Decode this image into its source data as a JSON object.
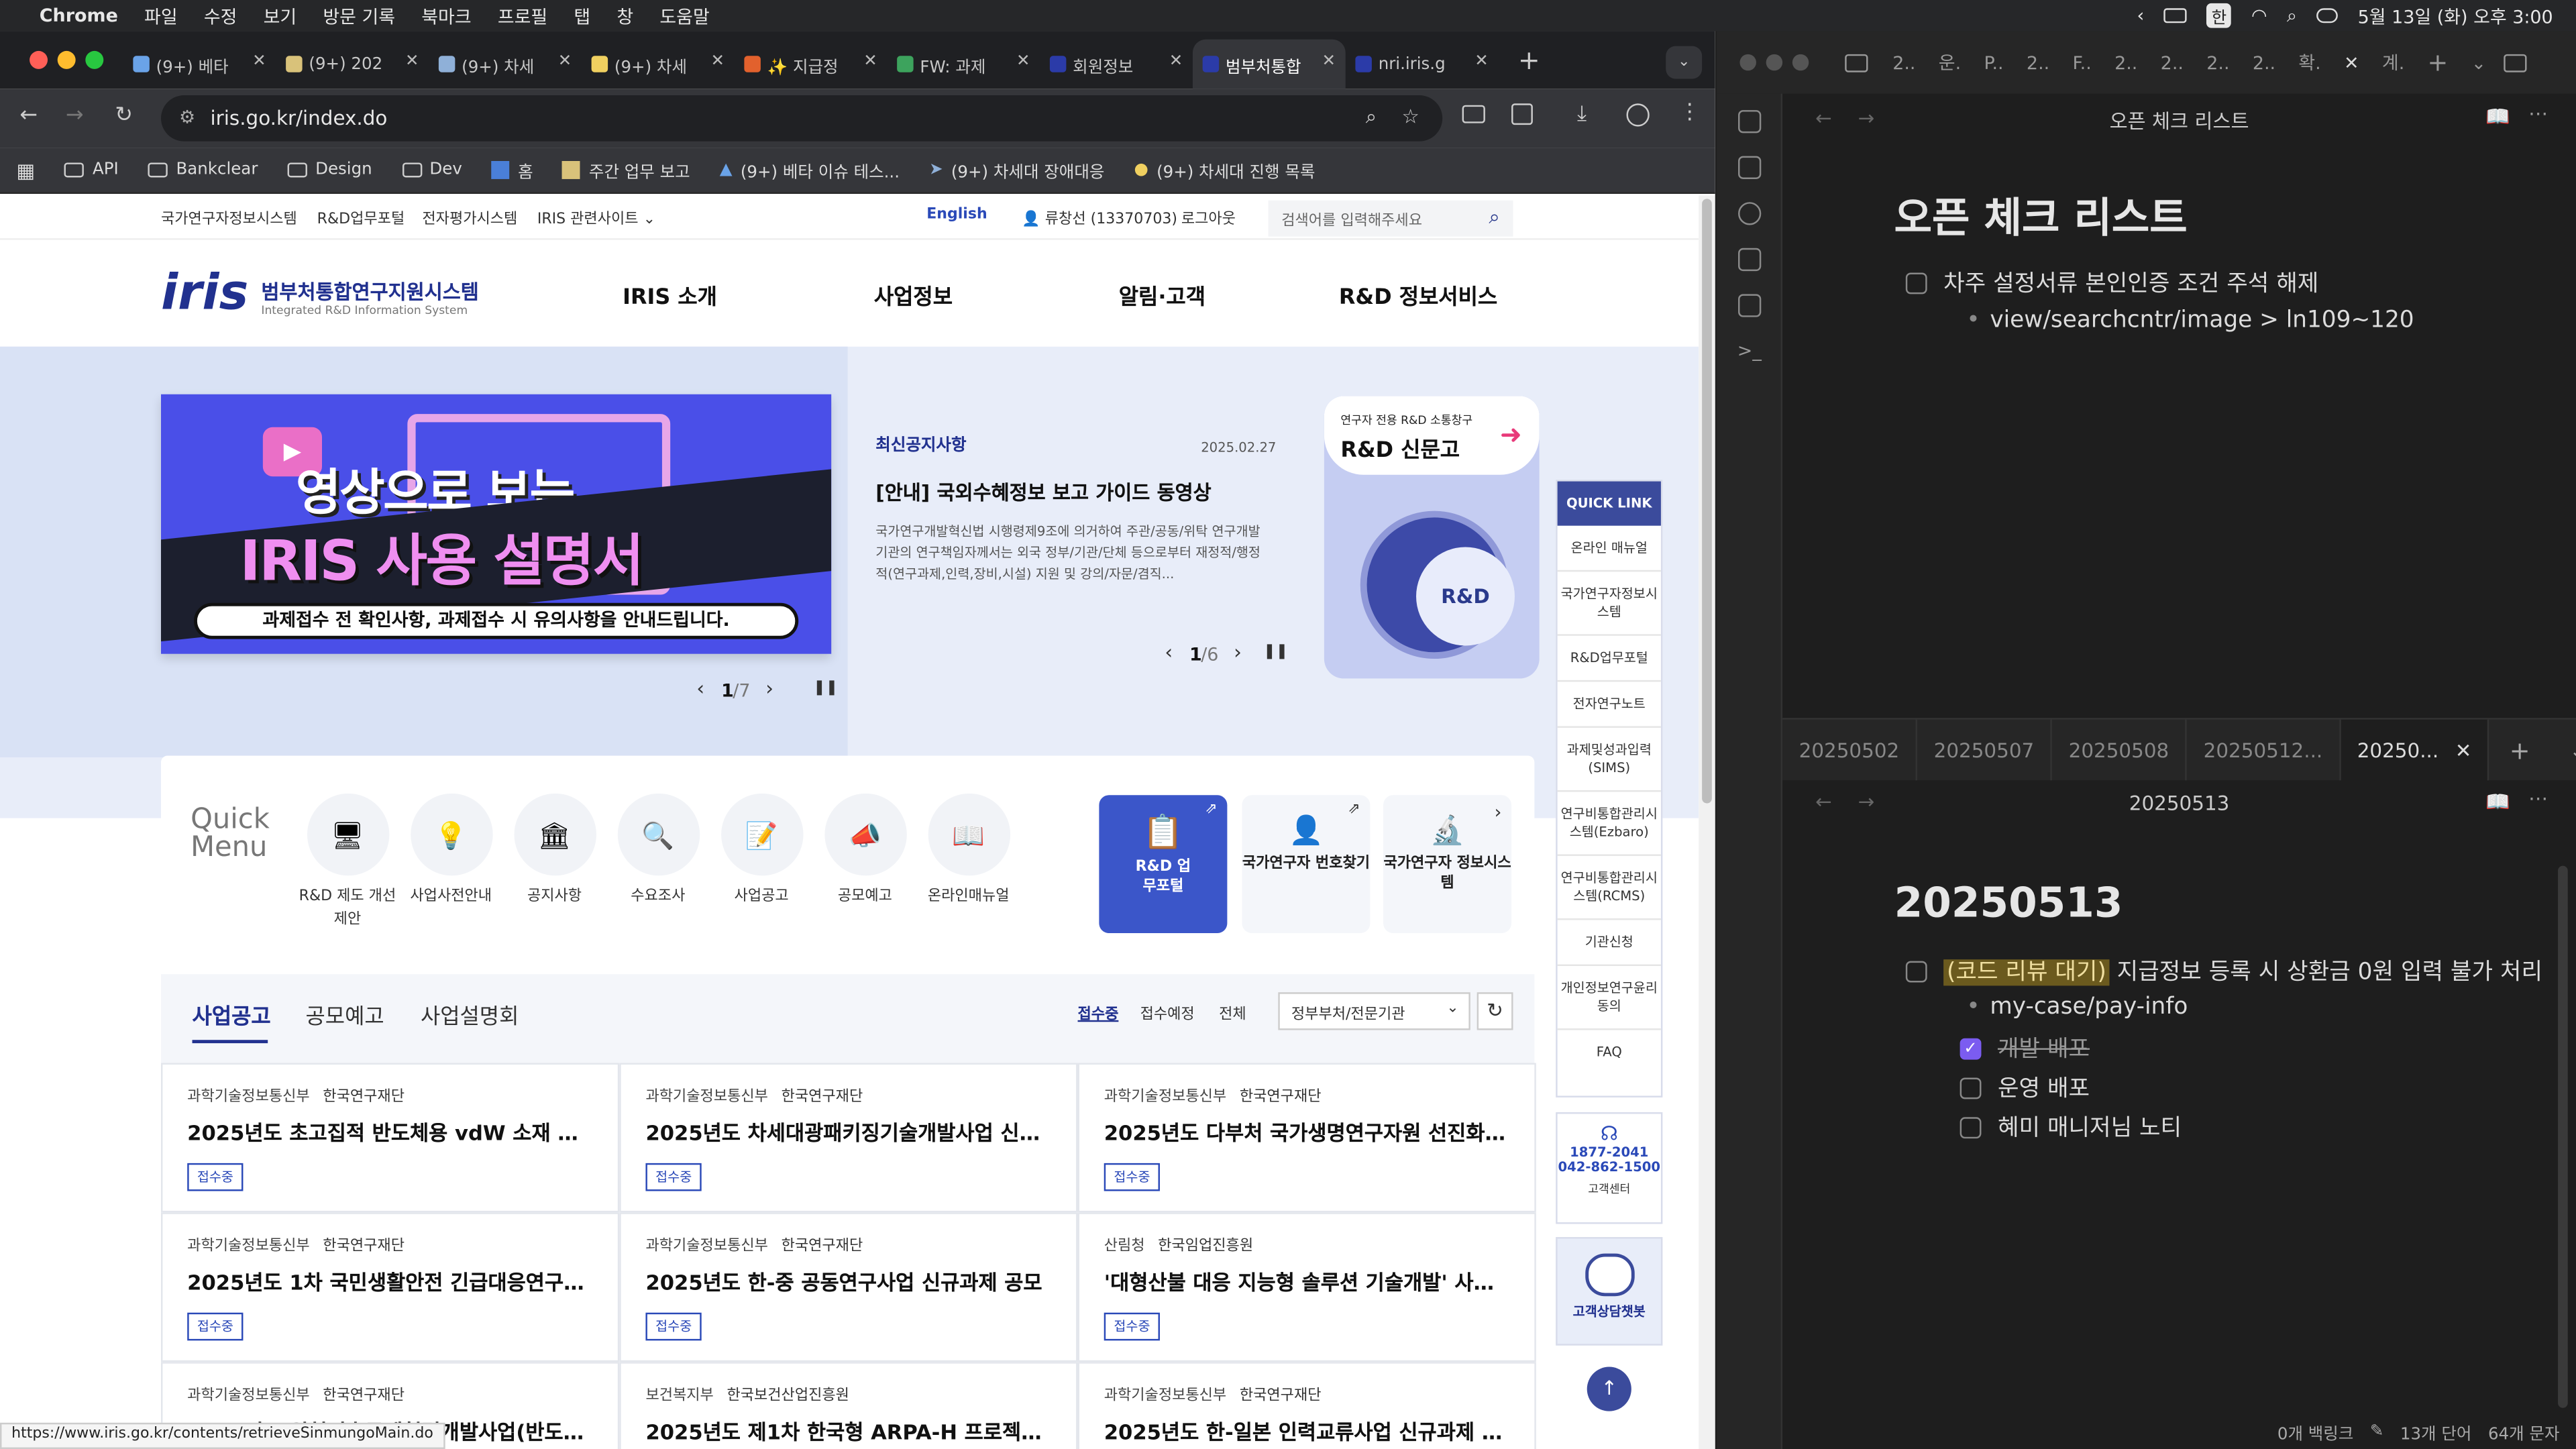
{
  "menubar": {
    "app": "Chrome",
    "items": [
      "파일",
      "수정",
      "보기",
      "방문 기록",
      "북마크",
      "프로필",
      "탭",
      "창",
      "도움말"
    ],
    "ime": "한",
    "clock": "5월 13일 (화) 오후 3:00"
  },
  "chrome": {
    "tabs": [
      {
        "label": "(9+) 베타",
        "color": "#6aa3e8"
      },
      {
        "label": "(9+) 202",
        "color": "#d9c27a"
      },
      {
        "label": "(9+) 차세",
        "color": "#8fb0d8"
      },
      {
        "label": "(9+) 차세",
        "color": "#f0d060"
      },
      {
        "label": "✨ 지급정",
        "color": "#e2612d"
      },
      {
        "label": "FW: 과제",
        "color": "#3da35d"
      },
      {
        "label": "회원정보",
        "color": "#2b3ba8"
      },
      {
        "label": "범부처통합",
        "color": "#2b3ba8"
      },
      {
        "label": "nri.iris.g",
        "color": "#2b3ba8"
      }
    ],
    "url": "iris.go.kr/index.do",
    "bookmarks": [
      "API",
      "Bankclear",
      "Design",
      "Dev",
      "홈",
      "주간 업무 보고",
      "(9+) 베타 이슈 테스...",
      "(9+) 차세대 장애대응",
      "(9+) 차세대 진행 목록"
    ],
    "status_url": "https://www.iris.go.kr/contents/retrieveSinmungoMain.do"
  },
  "iris": {
    "util_links": [
      "국가연구자정보시스템",
      "R&D업무포털",
      "전자평가시스템",
      "IRIS 관련사이트"
    ],
    "english": "English",
    "user": "류창선 (13370703)",
    "logout": "로그아웃",
    "search_placeholder": "검색어를 입력해주세요",
    "logo": "iris",
    "logo_title": "범부처통합연구지원시스템",
    "logo_sub": "Integrated R&D Information System",
    "gnb": [
      "IRIS 소개",
      "사업정보",
      "알림·고객",
      "R&D 정보서비스"
    ],
    "banner": {
      "line1": "영상으로 보는",
      "line2": "IRIS 사용 설명서",
      "caption": "과제접수 전 확인사항, 과제접수 시 유의사항을 안내드립니다.",
      "pager": "1",
      "pager_total": "/7"
    },
    "notice": {
      "category": "최신공지사항",
      "date": "2025.02.27",
      "title": "[안내] 국외수혜정보 보고 가이드 동영상",
      "body": "국가연구개발혁신법 시행령제9조에 의거하여 주관/공동/위탁 연구개발기관의 연구책임자께서는 외국 정부/기관/단체 등으로부터 재정적/행정적(연구과제,인력,장비,시설) 지원 및 강의/자문/겸직...",
      "pager": "1",
      "pager_total": "/6"
    },
    "sinmungo": {
      "small": "연구자 전용 R&D 소통창구",
      "title": "R&D 신문고",
      "drum_label": "R&D"
    },
    "quick_menu_title": "Quick Menu",
    "quick_menu": [
      "R&D 제도 개선 제안",
      "사업사전안내",
      "공지사항",
      "수요조사",
      "사업공고",
      "공모예고",
      "온라인매뉴얼"
    ],
    "portal_cards": [
      {
        "label": "R&D 업무포털"
      },
      {
        "label": "국가연구자 번호찾기"
      },
      {
        "label": "국가연구자 정보시스템"
      }
    ],
    "quick_link_title": "QUICK LINK",
    "quick_link": [
      "온라인 매뉴얼",
      "국가연구자정보시스템",
      "R&D업무포털",
      "전자연구노트",
      "과제및성과입력 (SIMS)",
      "연구비통합관리시스템(Ezbaro)",
      "연구비통합관리시스템(RCMS)",
      "기관신청",
      "개인정보연구윤리동의",
      "FAQ"
    ],
    "support": {
      "phone1": "1877-2041",
      "phone2": "042-862-1500",
      "label": "고객센터"
    },
    "chatbot": "고객상담챗봇",
    "board_tabs": [
      "사업공고",
      "공모예고",
      "사업설명회"
    ],
    "filters": [
      "접수중",
      "접수예정",
      "전체"
    ],
    "agency_select": "정부부처/전문기관",
    "cards": [
      {
        "ministry": "과학기술정보통신부",
        "agency": "한국연구재단",
        "title": "2025년도 초고집적 반도체용 vdW 소재 및 공...",
        "status": "접수중"
      },
      {
        "ministry": "과학기술정보통신부",
        "agency": "한국연구재단",
        "title": "2025년도 차세대광패키징기술개발사업 신규...",
        "status": "접수중"
      },
      {
        "ministry": "과학기술정보통신부",
        "agency": "한국연구재단",
        "title": "2025년도 다부처 국가생명연구자원 선진화사...",
        "status": "접수중"
      },
      {
        "ministry": "과학기술정보통신부",
        "agency": "한국연구재단",
        "title": "2025년도 1차 국민생활안전 긴급대응연구(2...",
        "status": "접수중"
      },
      {
        "ministry": "과학기술정보통신부",
        "agency": "한국연구재단",
        "title": "2025년도 한-중 공동연구사업 신규과제 공모",
        "status": "접수중"
      },
      {
        "ministry": "산림청",
        "agency": "한국임업진흥원",
        "title": "'대형산불 대응 지능형 솔루션 기술개발' 사업 2...",
        "status": "접수중"
      },
      {
        "ministry": "과학기술정보통신부",
        "agency": "한국연구재단",
        "title": "2025년도 원천기술국제협력개발사업(반도체·...",
        "status": ""
      },
      {
        "ministry": "보건복지부",
        "agency": "한국보건산업진흥원",
        "title": "2025년도 제1차 한국형 ARPA-H 프로젝트 신...",
        "status": ""
      },
      {
        "ministry": "과학기술정보통신부",
        "agency": "한국연구재단",
        "title": "2025년도 한-일본 인력교류사업 신규과제 공모",
        "status": ""
      }
    ]
  },
  "obsidian": {
    "top_tabs": [
      "2..",
      "운.",
      "P..",
      "2..",
      "F..",
      "2..",
      "2..",
      "2..",
      "2..",
      "확.",
      "계."
    ],
    "pane1": {
      "title": "오픈 체크 리스트",
      "heading": "오픈 체크 리스트",
      "task": "차주 설정서류 본인인증 조건 주석 해제",
      "sub": "view/searchcntr/image > ln109~120"
    },
    "pane2_tabs": [
      "20250502",
      "20250507",
      "20250508",
      "20250512...",
      "20250..."
    ],
    "pane2": {
      "title": "20250513",
      "heading": "20250513",
      "tag": "(코드 리뷰 대기)",
      "task": " 지급정보 등록 시 상환금 0원 입력 불가 처리",
      "sub": "my-case/pay-info",
      "subtasks": [
        {
          "label": "개발 배포",
          "done": true
        },
        {
          "label": "운영 배포",
          "done": false
        },
        {
          "label": "혜미 매니저님 노티",
          "done": false
        }
      ]
    },
    "status": {
      "backlinks": "0개 백링크",
      "words": "13개 단어",
      "chars": "64개 문자"
    }
  }
}
